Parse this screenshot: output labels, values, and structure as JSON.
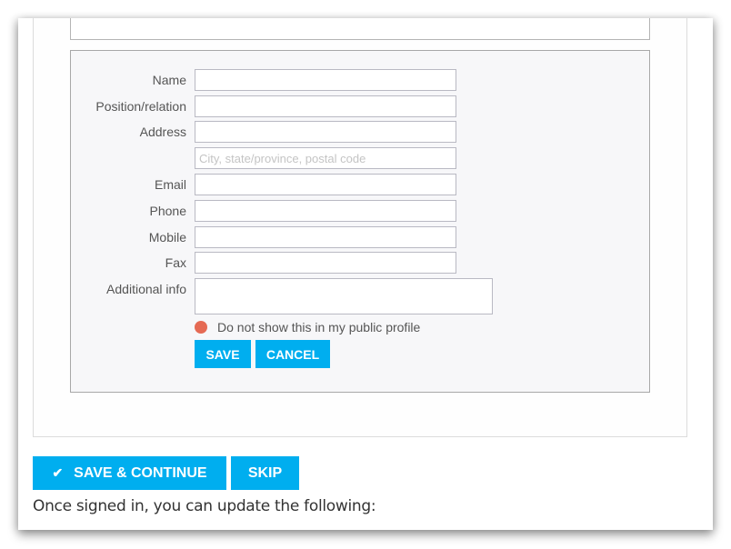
{
  "form": {
    "fields": [
      {
        "label": "Name",
        "value": "",
        "placeholder": ""
      },
      {
        "label": "Position/relation",
        "value": "",
        "placeholder": ""
      },
      {
        "label": "Address",
        "value": "",
        "placeholder": ""
      },
      {
        "label": "",
        "value": "",
        "placeholder": "City, state/province, postal code"
      },
      {
        "label": "Email",
        "value": "",
        "placeholder": ""
      },
      {
        "label": "Phone",
        "value": "",
        "placeholder": ""
      },
      {
        "label": "Mobile",
        "value": "",
        "placeholder": ""
      },
      {
        "label": "Fax",
        "value": "",
        "placeholder": ""
      }
    ],
    "additional_info": {
      "label": "Additional info",
      "value": ""
    },
    "privacy": {
      "label": "Do not show this in my public profile",
      "checked": false,
      "color": "#e56a54"
    },
    "save_label": "SAVE",
    "cancel_label": "CANCEL"
  },
  "actions": {
    "save_continue_label": "SAVE & CONTINUE",
    "save_continue_icon": "check-icon",
    "skip_label": "SKIP"
  },
  "footer": {
    "text": "Once signed in, you can update the following:"
  },
  "colors": {
    "accent": "#00aeef",
    "panel_bg": "#f7f7f9"
  }
}
